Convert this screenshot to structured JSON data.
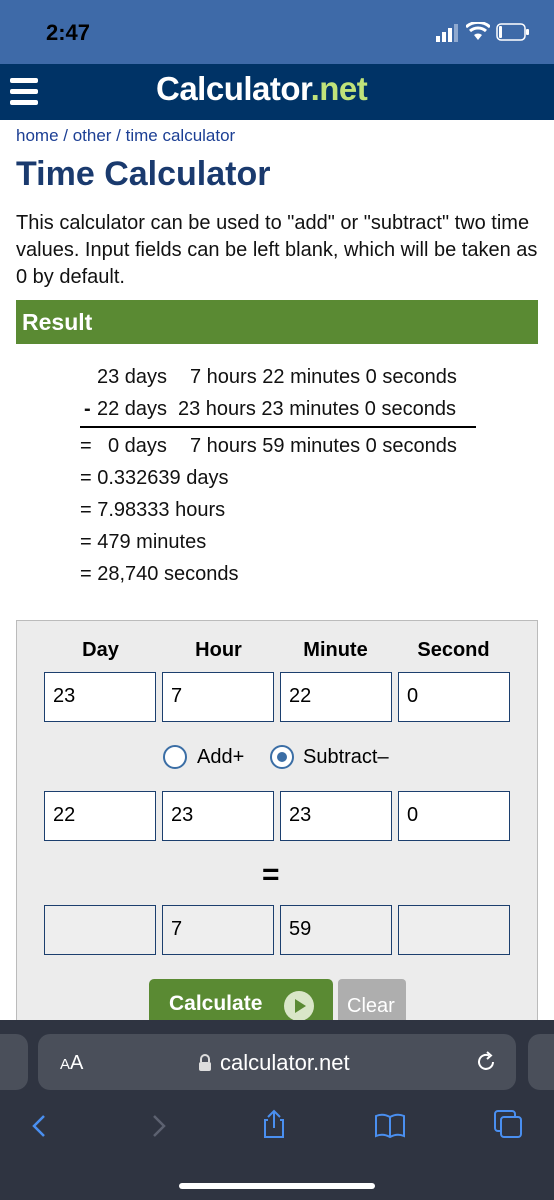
{
  "status": {
    "time": "2:47"
  },
  "header": {
    "logo_main": "Calculator",
    "logo_dot": ".",
    "logo_net": "net"
  },
  "breadcrumb": {
    "home": "home",
    "sep": " / ",
    "other": "other",
    "current": "time calculator"
  },
  "title": "Time Calculator",
  "description": "This calculator can be used to \"add\" or \"subtract\" two time values. Input fields can be left blank, which will be taken as 0 by default.",
  "result": {
    "label": "Result",
    "line1": {
      "days": "23 days",
      "rest": "7 hours 22 minutes 0 seconds"
    },
    "line2": {
      "op": "-",
      "days": "22 days",
      "rest": "23 hours 23 minutes 0 seconds"
    },
    "line3": {
      "eq": "=",
      "days": "0 days",
      "rest": "7 hours 59 minutes 0 seconds"
    },
    "extra": [
      "= 0.332639 days",
      "= 7.98333 hours",
      "= 479 minutes",
      "= 28,740 seconds"
    ]
  },
  "form": {
    "columns": [
      "Day",
      "Hour",
      "Minute",
      "Second"
    ],
    "row1": [
      "23",
      "7",
      "22",
      "0"
    ],
    "row2": [
      "22",
      "23",
      "23",
      "0"
    ],
    "row3": [
      "",
      "7",
      "59",
      ""
    ],
    "add_label": "Add+",
    "subtract_label": "Subtract–",
    "selected_operation": "subtract",
    "equals": "=",
    "calculate_label": "Calculate",
    "clear_label": "Clear"
  },
  "browser": {
    "aa_big": "A",
    "aa_small": "A",
    "url": "calculator.net"
  },
  "colors": {
    "header": "#003366",
    "status": "#3e6aa8",
    "accent_green": "#5a8a33",
    "link": "#1c3f94"
  },
  "icons": [
    "menu-icon",
    "play-icon",
    "lock-icon",
    "reload-icon",
    "back-icon",
    "forward-icon",
    "share-icon",
    "bookmarks-icon",
    "tabs-icon",
    "signal-icon",
    "wifi-icon",
    "battery-icon"
  ]
}
